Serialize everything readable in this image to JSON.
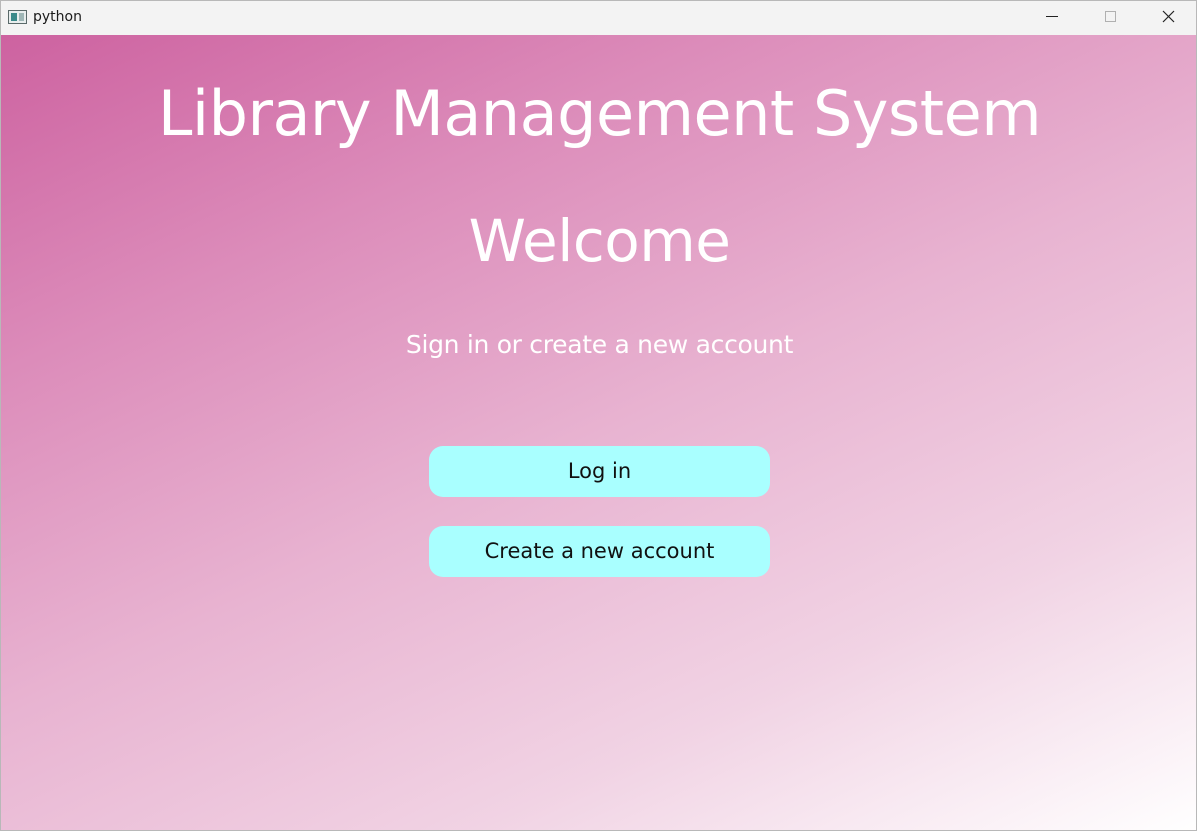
{
  "window": {
    "title": "python"
  },
  "title_bar": {
    "icons": [
      "app-icon",
      "minimize-icon",
      "maximize-icon",
      "close-icon"
    ]
  },
  "page": {
    "app_title": "Library Management System",
    "welcome": "Welcome",
    "subtitle": "Sign in or create a new account"
  },
  "buttons": {
    "login_label": "Log in",
    "create_label": "Create a new account"
  },
  "colors": {
    "gradient_start": "#cd62a0",
    "gradient_end": "#ffffff",
    "button_bg": "#a9ffff",
    "heading_text": "#ffffff",
    "button_text": "#111111"
  }
}
